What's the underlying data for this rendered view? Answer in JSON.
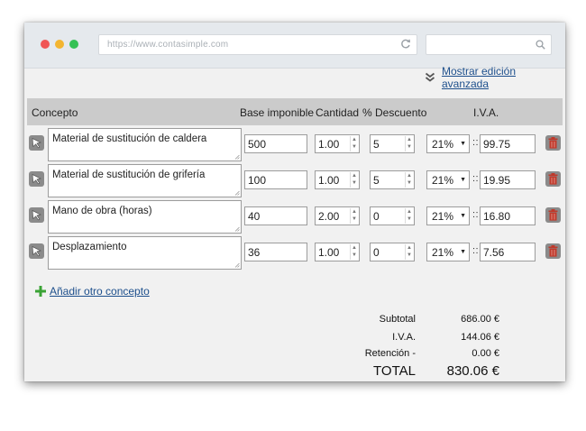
{
  "browser": {
    "url": "https://www.contasimple.com",
    "search_value": ""
  },
  "toolbar": {
    "advanced_link": "Mostrar edición avanzada"
  },
  "table": {
    "headers": {
      "concept": "Concepto",
      "base": "Base imponible",
      "quantity": "Cantidad",
      "discount": "% Descuento",
      "vat": "I.V.A."
    },
    "rows": [
      {
        "concept": "Material de sustitución de caldera",
        "base": "500",
        "quantity": "1.00",
        "discount": "5",
        "vat_rate": "21%",
        "vat_amount": "99.75"
      },
      {
        "concept": "Material de sustitución de grifería",
        "base": "100",
        "quantity": "1.00",
        "discount": "5",
        "vat_rate": "21%",
        "vat_amount": "19.95"
      },
      {
        "concept": "Mano de obra (horas)",
        "base": "40",
        "quantity": "2.00",
        "discount": "0",
        "vat_rate": "21%",
        "vat_amount": "16.80"
      },
      {
        "concept": "Desplazamiento",
        "base": "36",
        "quantity": "1.00",
        "discount": "0",
        "vat_rate": "21%",
        "vat_amount": "7.56"
      }
    ],
    "separator": "::",
    "add_concept": "Añadir otro concepto"
  },
  "totals": {
    "subtotal_label": "Subtotal",
    "subtotal_value": "686.00 €",
    "vat_label": "I.V.A.",
    "vat_value": "144.06 €",
    "retention_label": "Retención -",
    "retention_value": "0.00 €",
    "total_label": "TOTAL",
    "total_value": "830.06 €"
  },
  "colors": {
    "link": "#1d4f8c",
    "trash": "#c0392b",
    "plus": "#3aa335",
    "header_bg": "#cbcbcb"
  },
  "icons": {
    "cursor": "cursor-arrow-icon",
    "trash": "trash-icon",
    "plus": "plus-icon",
    "reload": "reload-icon",
    "search": "search-icon",
    "chevrons": "double-chevron-down-icon"
  }
}
